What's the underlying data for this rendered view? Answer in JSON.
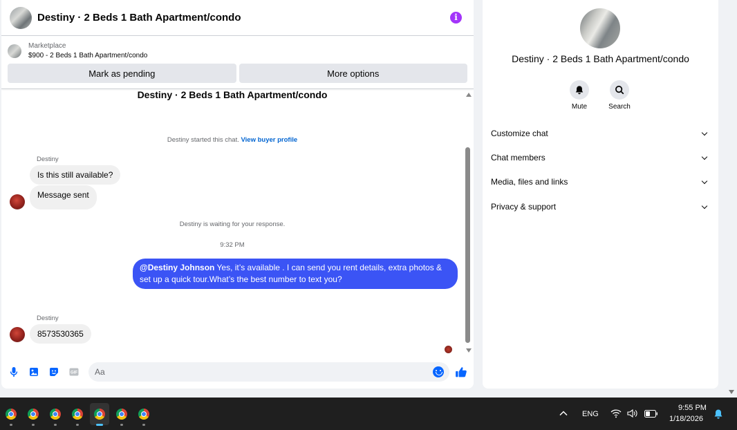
{
  "chat": {
    "header_title": "Destiny · 2 Beds 1 Bath Apartment/condo",
    "info_icon": "info-icon",
    "marketplace_label": "Marketplace",
    "listing_summary": "$900 - 2 Beds 1 Bath Apartment/condo",
    "mark_pending_label": "Mark as pending",
    "more_options_label": "More options"
  },
  "messages": {
    "conversation_title": "Destiny · 2 Beds 1 Bath Apartment/condo",
    "started_text": "Destiny started this chat.",
    "view_profile_link": "View buyer profile",
    "sender_1": "Destiny",
    "msg_1": "Is this still available?",
    "msg_2": "Message sent",
    "waiting_text": "Destiny is waiting for your response.",
    "timestamp": "9:32 PM",
    "outgoing_mention": "@Destiny Johnson",
    "outgoing_text": " Yes, it’s available .  I can send you rent details, extra photos & set up a quick tour.What’s the best number to text you?",
    "sender_2": "Destiny",
    "msg_3": "8573530365"
  },
  "composer": {
    "placeholder": "Aa",
    "icons": [
      "microphone-icon",
      "photo-icon",
      "sticker-icon",
      "gif-icon",
      "emoji-icon",
      "thumbs-up-icon"
    ],
    "gif_label": "GIF"
  },
  "details": {
    "title": "Destiny · 2 Beds 1 Bath Apartment/condo",
    "mute_label": "Mute",
    "search_label": "Search",
    "sections": [
      "Customize chat",
      "Chat members",
      "Media, files and links",
      "Privacy & support"
    ]
  },
  "taskbar": {
    "language": "ENG",
    "time": "9:55 PM",
    "date": "1/18/2026"
  },
  "colors": {
    "accent": "#0866ff",
    "outgoing_bubble": "#3b54f5",
    "info": "#a334fa"
  }
}
